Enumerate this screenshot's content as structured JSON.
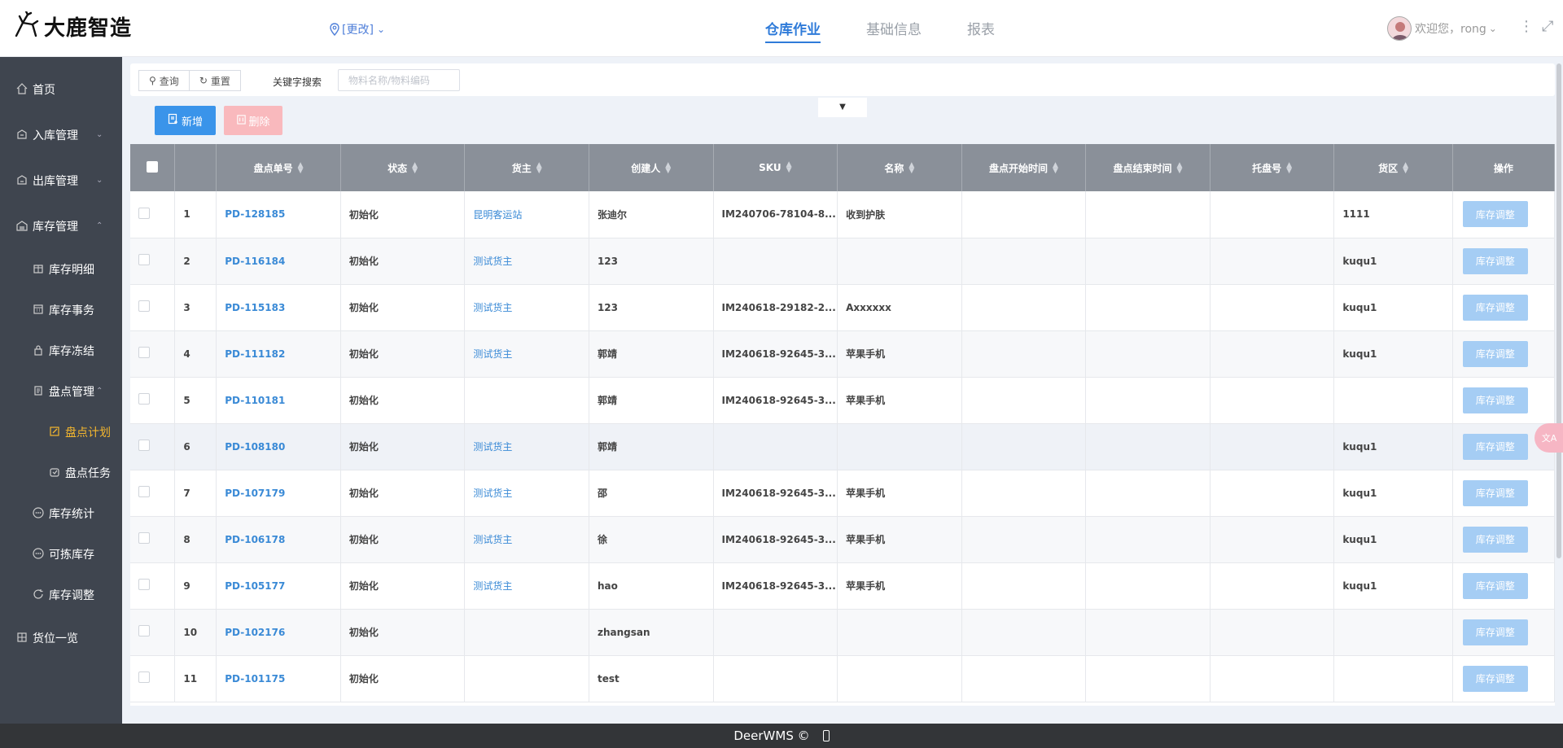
{
  "header": {
    "logo_text": "大鹿智造",
    "location_label": "[更改]",
    "nav": [
      "仓库作业",
      "基础信息",
      "报表"
    ],
    "active_nav": "仓库作业",
    "welcome": "欢迎您，rong"
  },
  "sidebar": {
    "items": [
      {
        "label": "首页",
        "icon": "home-icon",
        "level": 0
      },
      {
        "label": "入库管理",
        "icon": "inbound-icon",
        "level": 0,
        "chevron": "down"
      },
      {
        "label": "出库管理",
        "icon": "outbound-icon",
        "level": 0,
        "chevron": "down"
      },
      {
        "label": "库存管理",
        "icon": "warehouse-icon",
        "level": 0,
        "chevron": "up"
      },
      {
        "label": "库存明细",
        "icon": "detail-icon",
        "level": 1
      },
      {
        "label": "库存事务",
        "icon": "calendar-icon",
        "level": 1
      },
      {
        "label": "库存冻结",
        "icon": "lock-icon",
        "level": 1
      },
      {
        "label": "盘点管理",
        "icon": "document-icon",
        "level": 1,
        "chevron": "up"
      },
      {
        "label": "盘点计划",
        "icon": "edit-icon",
        "level": 2,
        "active": true
      },
      {
        "label": "盘点任务",
        "icon": "task-icon",
        "level": 2
      },
      {
        "label": "库存统计",
        "icon": "dots-icon",
        "level": 1
      },
      {
        "label": "可拣库存",
        "icon": "dots-icon",
        "level": 1
      },
      {
        "label": "库存调整",
        "icon": "refresh-icon",
        "level": 1
      },
      {
        "label": "货位一览",
        "icon": "grid-icon",
        "level": 0
      }
    ]
  },
  "search": {
    "query_btn": "查询",
    "reset_btn": "重置",
    "keyword_label": "关键字搜索",
    "keyword_placeholder": "物料名称/物料编码"
  },
  "toolbar": {
    "add_btn": "新增",
    "delete_btn": "删除"
  },
  "table": {
    "columns": [
      "盘点单号",
      "状态",
      "货主",
      "创建人",
      "SKU",
      "名称",
      "盘点开始时间",
      "盘点结束时间",
      "托盘号",
      "货区",
      "操作"
    ],
    "action_label": "库存调整",
    "rows": [
      {
        "idx": "1",
        "no": "PD-128185",
        "status": "初始化",
        "owner": "昆明客运站",
        "creator": "张迪尔",
        "sku": "IM240706-78104-8...",
        "name": "收到护肤",
        "start": "",
        "end": "",
        "pallet": "",
        "zone": "1111"
      },
      {
        "idx": "2",
        "no": "PD-116184",
        "status": "初始化",
        "owner": "测试货主",
        "creator": "123",
        "sku": "",
        "name": "",
        "start": "",
        "end": "",
        "pallet": "",
        "zone": "kuqu1"
      },
      {
        "idx": "3",
        "no": "PD-115183",
        "status": "初始化",
        "owner": "测试货主",
        "creator": "123",
        "sku": "IM240618-29182-2...",
        "name": "Axxxxxx",
        "start": "",
        "end": "",
        "pallet": "",
        "zone": "kuqu1"
      },
      {
        "idx": "4",
        "no": "PD-111182",
        "status": "初始化",
        "owner": "测试货主",
        "creator": "郭靖",
        "sku": "IM240618-92645-3...",
        "name": "苹果手机",
        "start": "",
        "end": "",
        "pallet": "",
        "zone": "kuqu1"
      },
      {
        "idx": "5",
        "no": "PD-110181",
        "status": "初始化",
        "owner": "",
        "creator": "郭靖",
        "sku": "IM240618-92645-3...",
        "name": "苹果手机",
        "start": "",
        "end": "",
        "pallet": "",
        "zone": ""
      },
      {
        "idx": "6",
        "no": "PD-108180",
        "status": "初始化",
        "owner": "测试货主",
        "creator": "郭靖",
        "sku": "",
        "name": "",
        "start": "",
        "end": "",
        "pallet": "",
        "zone": "kuqu1"
      },
      {
        "idx": "7",
        "no": "PD-107179",
        "status": "初始化",
        "owner": "测试货主",
        "creator": "邵",
        "sku": "IM240618-92645-3...",
        "name": "苹果手机",
        "start": "",
        "end": "",
        "pallet": "",
        "zone": "kuqu1"
      },
      {
        "idx": "8",
        "no": "PD-106178",
        "status": "初始化",
        "owner": "测试货主",
        "creator": "徐",
        "sku": "IM240618-92645-3...",
        "name": "苹果手机",
        "start": "",
        "end": "",
        "pallet": "",
        "zone": "kuqu1"
      },
      {
        "idx": "9",
        "no": "PD-105177",
        "status": "初始化",
        "owner": "测试货主",
        "creator": "hao",
        "sku": "IM240618-92645-3...",
        "name": "苹果手机",
        "start": "",
        "end": "",
        "pallet": "",
        "zone": "kuqu1"
      },
      {
        "idx": "10",
        "no": "PD-102176",
        "status": "初始化",
        "owner": "",
        "creator": "zhangsan",
        "sku": "",
        "name": "",
        "start": "",
        "end": "",
        "pallet": "",
        "zone": ""
      },
      {
        "idx": "11",
        "no": "PD-101175",
        "status": "初始化",
        "owner": "",
        "creator": "test",
        "sku": "",
        "name": "",
        "start": "",
        "end": "",
        "pallet": "",
        "zone": ""
      }
    ]
  },
  "footer": {
    "text": "DeerWMS ©"
  },
  "colors": {
    "primary": "#3a94ea",
    "sidebar_bg": "#3f454f",
    "active_menu": "#f5b72e",
    "table_header": "#8a9099",
    "link": "#3a8ad6"
  }
}
